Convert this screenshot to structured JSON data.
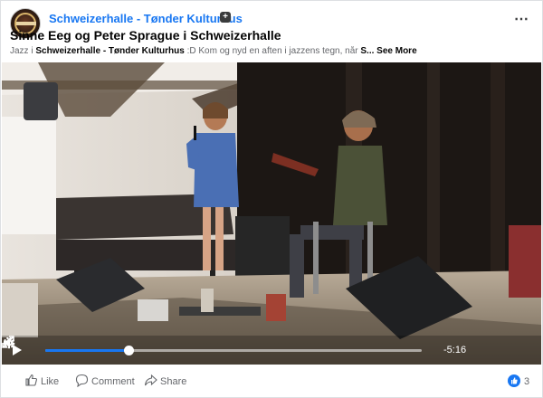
{
  "post": {
    "page_name": "Schweizerhalle - Tønder Kulturhus",
    "title": "Sinne Eeg og Peter Sprague i Schweizerhalle",
    "text_prefix": "Jazz i ",
    "text_bold": "Schweizerhalle - Tønder Kulturhus",
    "text_suffix": " :D Kom og nyd en aften i jazzens tegn, når ",
    "text_trunc": "S...",
    "see_more": "See More",
    "more_icon": "⋯",
    "follow_icon": "+"
  },
  "video": {
    "progress_fraction": 0.22,
    "time_remaining": "-5:16"
  },
  "actions": {
    "like": "Like",
    "comment": "Comment",
    "share": "Share",
    "reaction_count": "3"
  },
  "colors": {
    "link": "#1877f2",
    "text_secondary": "#65676b"
  }
}
